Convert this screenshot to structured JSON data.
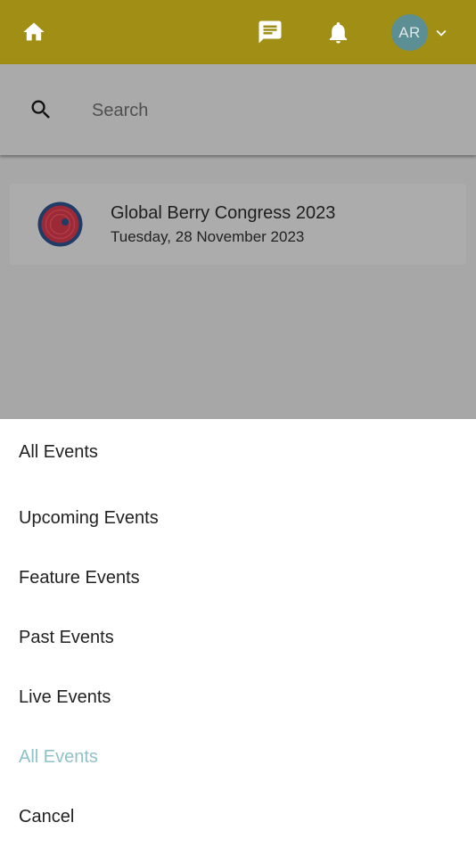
{
  "header": {
    "avatar_initials": "AR",
    "icons": [
      "home-icon",
      "chat-icon",
      "bell-icon",
      "chevron-down-icon"
    ],
    "bar_color": "#a18e14",
    "avatar_color": "#5c8f94"
  },
  "search": {
    "placeholder": "Search",
    "value": ""
  },
  "events": [
    {
      "title": "Global Berry Congress 2023",
      "date": "Tuesday, 28 November 2023"
    }
  ],
  "filter_sheet": {
    "header": "All Events",
    "options": [
      {
        "label": "Upcoming Events",
        "selected": false
      },
      {
        "label": "Feature Events",
        "selected": false
      },
      {
        "label": "Past Events",
        "selected": false
      },
      {
        "label": "Live Events",
        "selected": false
      },
      {
        "label": "All Events",
        "selected": true
      }
    ],
    "cancel_label": "Cancel",
    "selected_color": "#8fc2c8"
  }
}
